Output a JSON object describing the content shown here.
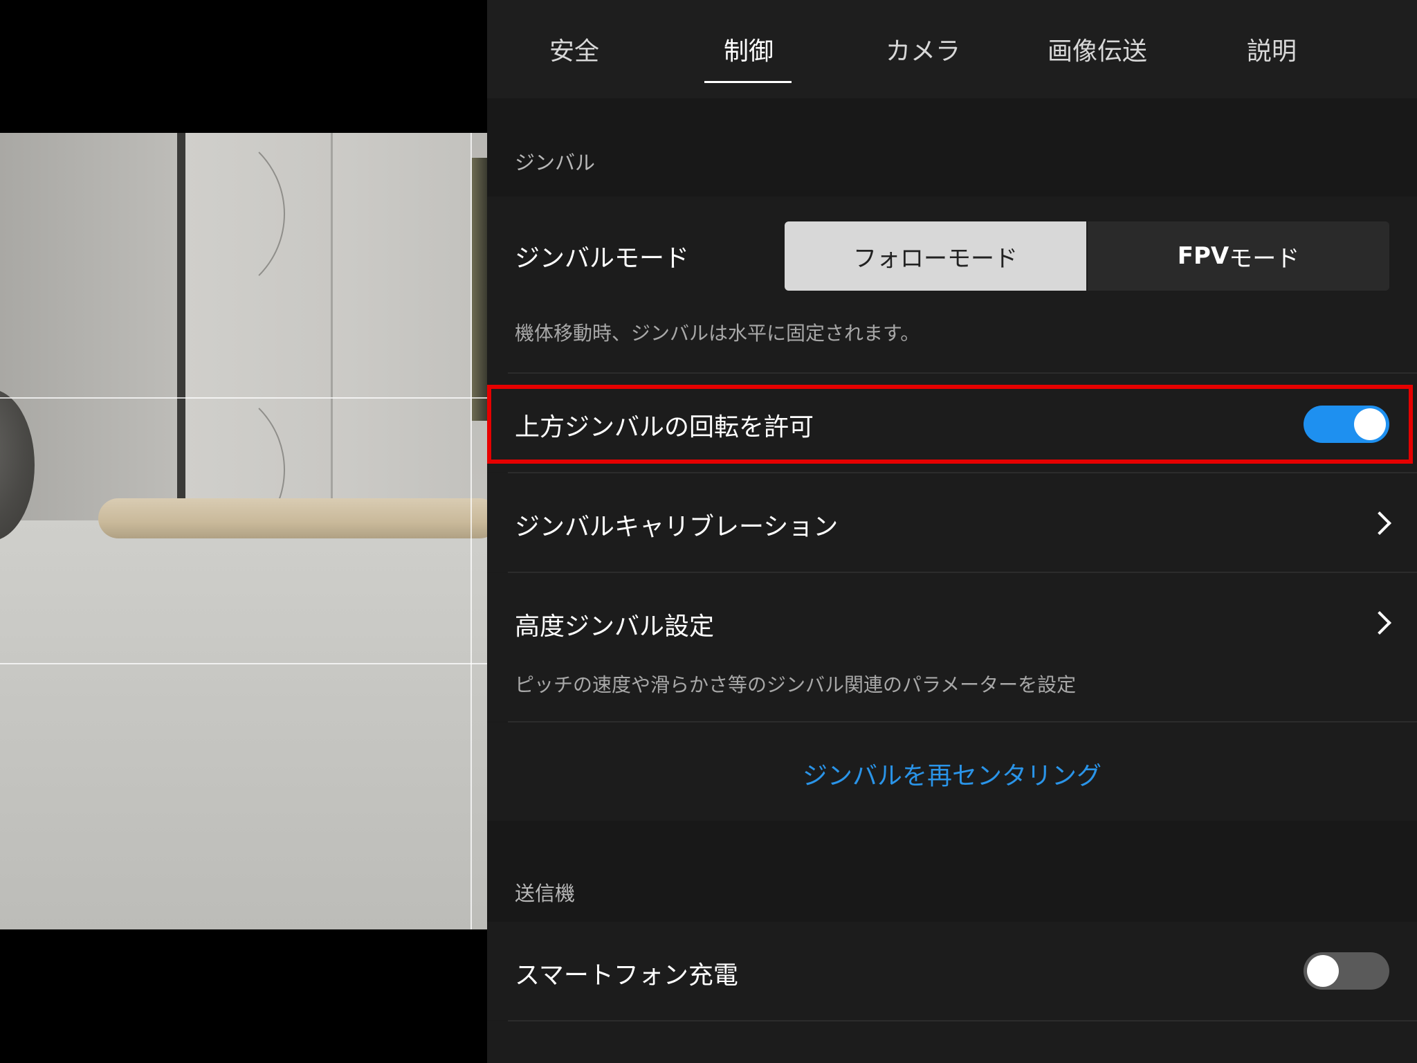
{
  "tabs": [
    {
      "label": "安全"
    },
    {
      "label": "制御",
      "active": true
    },
    {
      "label": "カメラ"
    },
    {
      "label": "画像伝送"
    },
    {
      "label": "説明"
    }
  ],
  "gimbal_section": {
    "header": "ジンバル",
    "mode": {
      "label": "ジンバルモード",
      "options": [
        "フォローモード",
        "FPV",
        "モード"
      ],
      "selected": "フォローモード",
      "description": "機体移動時、ジンバルは水平に固定されます。"
    },
    "allow_upward_rotation": {
      "label": "上方ジンバルの回転を許可",
      "enabled": true
    },
    "calibration": {
      "label": "ジンバルキャリブレーション"
    },
    "advanced": {
      "label": "高度ジンバル設定",
      "description": "ピッチの速度や滑らかさ等のジンバル関連のパラメーターを設定"
    },
    "recenter_label": "ジンバルを再センタリング"
  },
  "transmitter_section": {
    "header": "送信機",
    "smartphone_charging": {
      "label": "スマートフォン充電",
      "enabled": false
    }
  },
  "colors": {
    "accent": "#1e90f0",
    "link": "#2a94e8",
    "highlight": "#e60000",
    "panel_bg": "#1b1b1b"
  }
}
